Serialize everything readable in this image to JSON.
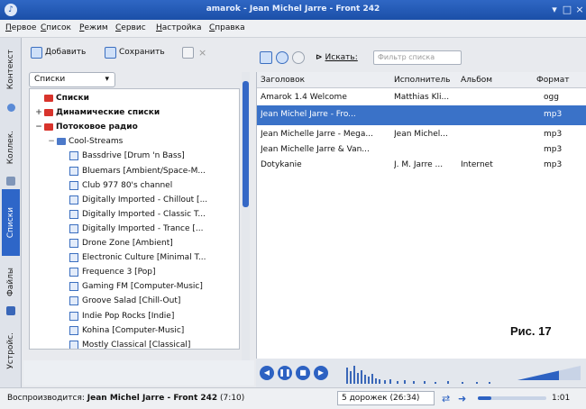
{
  "window": {
    "title": "amarok - Jean Michel Jarre - Front 242",
    "accent": "#2e66c8"
  },
  "menu": [
    {
      "first": "П",
      "rest": "ервое"
    },
    {
      "first": "С",
      "rest": "писок"
    },
    {
      "first": "Р",
      "rest": "ежим"
    },
    {
      "first": "С",
      "rest": "ервис"
    },
    {
      "first": "Н",
      "rest": "астройка"
    },
    {
      "first": "С",
      "rest": "правка"
    }
  ],
  "side_tabs": [
    "Контекст",
    "Коллек.",
    "Списки",
    "Файлы",
    "Устройс."
  ],
  "left_toolbar": {
    "add_label": "Добавить",
    "save_label": "Сохранить"
  },
  "lists_combo": "Списки",
  "tree": [
    {
      "label": "Списки",
      "level": 0,
      "bold": true,
      "icon": "folder-red",
      "expander": ""
    },
    {
      "label": "Динамические списки",
      "level": 0,
      "bold": true,
      "icon": "folder-red",
      "expander": "+"
    },
    {
      "label": "Потоковое радио",
      "level": 0,
      "bold": true,
      "icon": "folder-red",
      "expander": "−"
    },
    {
      "label": "Cool-Streams",
      "level": 1,
      "bold": false,
      "icon": "folder-blue",
      "expander": "−"
    },
    {
      "label": "Bassdrive [Drum 'n Bass]",
      "level": 2,
      "icon": "radio"
    },
    {
      "label": "Bluemars [Ambient/Space-M...",
      "level": 2,
      "icon": "radio"
    },
    {
      "label": "Club 977 80's channel",
      "level": 2,
      "icon": "radio"
    },
    {
      "label": "Digitally Imported - Chillout [...",
      "level": 2,
      "icon": "radio"
    },
    {
      "label": "Digitally Imported - Classic T...",
      "level": 2,
      "icon": "radio"
    },
    {
      "label": "Digitally Imported - Trance [...",
      "level": 2,
      "icon": "radio"
    },
    {
      "label": "Drone Zone [Ambient]",
      "level": 2,
      "icon": "radio"
    },
    {
      "label": "Electronic Culture [Minimal T...",
      "level": 2,
      "icon": "radio"
    },
    {
      "label": "Frequence 3 [Pop]",
      "level": 2,
      "icon": "radio"
    },
    {
      "label": "Gaming FM [Computer-Music]",
      "level": 2,
      "icon": "radio"
    },
    {
      "label": "Groove Salad [Chill-Out]",
      "level": 2,
      "icon": "radio"
    },
    {
      "label": "Indie Pop Rocks [Indie]",
      "level": 2,
      "icon": "radio"
    },
    {
      "label": "Kohina [Computer-Music]",
      "level": 2,
      "icon": "radio"
    },
    {
      "label": "Mostly Classical [Classical]",
      "level": 2,
      "icon": "radio"
    }
  ],
  "search": {
    "button_label": "Искать:",
    "placeholder": "Фильтр списка"
  },
  "playlist": {
    "columns": [
      "Заголовок",
      "Исполнитель",
      "Альбом",
      "Формат"
    ],
    "rows": [
      {
        "title": "Amarok 1.4 Welcome",
        "artist": "Matthias Kli...",
        "album": "",
        "format": "ogg",
        "selected": false
      },
      {
        "title": "Jean Michel Jarre - Fro...",
        "artist": "",
        "album": "",
        "format": "mp3",
        "selected": true
      },
      {
        "title": "Jean Michelle Jarre - Mega...",
        "artist": "Jean Michel...",
        "album": "",
        "format": "mp3",
        "selected": false
      },
      {
        "title": "Jean Michelle Jarre & Van...",
        "artist": "",
        "album": "",
        "format": "mp3",
        "selected": false
      },
      {
        "title": "Dotykanie",
        "artist": "J. M. Jarre ...",
        "album": "Internet",
        "format": "mp3",
        "selected": false
      }
    ]
  },
  "figure_label": "Рис. 17",
  "status": {
    "prefix": "Воспроизводится:",
    "track": "Jean Michel Jarre - Front 242",
    "count": "(7:10)",
    "tracks": "5 дорожек (26:34)",
    "time": "1:01",
    "progress_fraction": 0.2
  }
}
